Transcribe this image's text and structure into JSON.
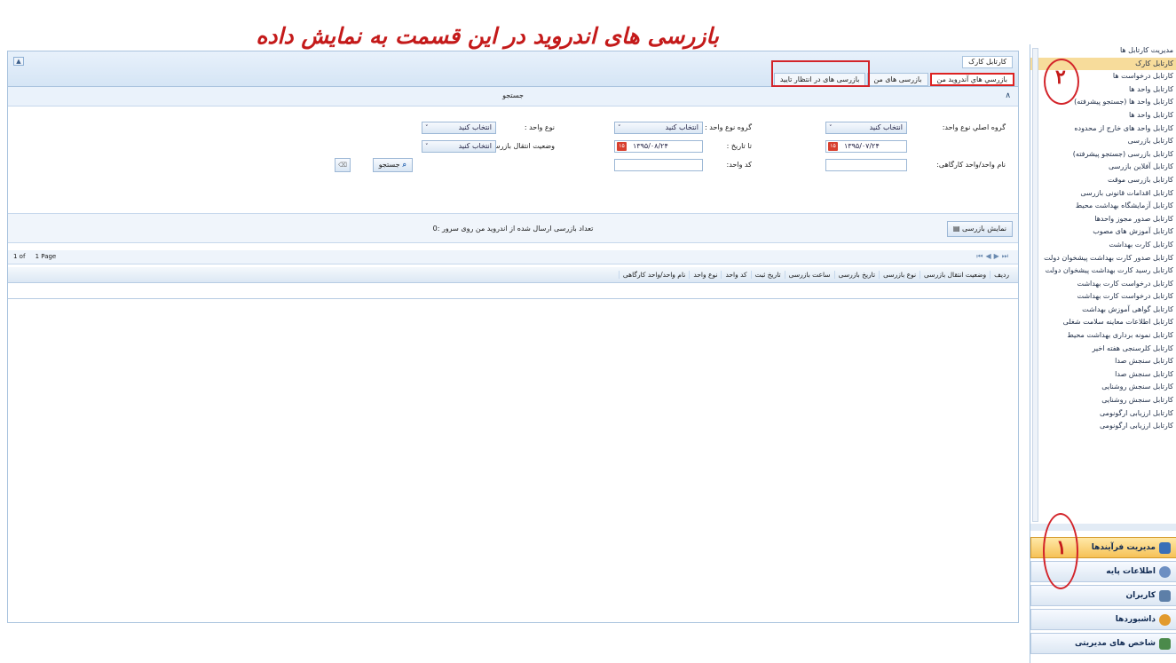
{
  "annotation": {
    "banner_text": "بازرسی های اندروید در این قسمت به نمایش داده می شود",
    "circle_1": "۱",
    "circle_2": "۲"
  },
  "main_panel": {
    "title": "کارتابل کارک",
    "tabs": [
      {
        "label": "بازرسي هاي آندرويد من",
        "active": true
      },
      {
        "label": "بازرسی های من",
        "active": false
      },
      {
        "label": "بازرسی های در انتظار تایید",
        "active": false
      }
    ],
    "collapse_glyph": "▲"
  },
  "search": {
    "header": "جستجو",
    "fields": {
      "main_group_label": "گروه اصلي نوع واحد:",
      "main_group_value": "انتخاب کنید",
      "unit_group_label": "گروه نوع واحد :",
      "unit_group_value": "انتخاب کنيد",
      "unit_type_label": "نوع واحد :",
      "unit_type_value": "انتخاب کنید",
      "from_date_value": "۱۳۹۵/۰۷/۲۴",
      "to_date_label": "تا تاریخ :",
      "to_date_value": "۱۳۹۵/۰۸/۲۴",
      "transfer_status_label": "وضعیت انتقال بازرسی:",
      "transfer_status_value": "انتخاب کنید",
      "unit_name_label": "نام واحد/واحد کارگاهی:",
      "unit_code_label": "کد واحد:",
      "search_button": "جستجو",
      "calendar_glyph": "۱۵"
    }
  },
  "status": {
    "show_button": "نمایش بازرسی",
    "count_text": "تعداد بازرسی ارسال شده از اندروید من روی سرور :0"
  },
  "pager": {
    "page_label": "Page",
    "page_number": "1",
    "of_label": "1 of"
  },
  "grid": {
    "columns": [
      "ردیف",
      "وضعیت انتقال بازرسی",
      "نوع بازرسی",
      "تاریخ بازرسی",
      "ساعت بازرسی",
      "تاریخ ثبت",
      "کد واحد",
      "نوع واحد",
      "نام واحد/واحد کارگاهی"
    ]
  },
  "sidebar": {
    "items": [
      "مدیریت کارتابل ها",
      "کارتابل کارک",
      "کارتابل درخواست ها",
      "کارتابل واحد ها",
      "کارتابل واحد ها (جستجو پیشرفته)",
      "کارتابل واحد ها",
      "کارتابل واحد های خارج از محدوده",
      "کارتابل بازرسی",
      "کارتابل بازرسی (جستجو پیشرفته)",
      "کارتابل آفلاین بازرسی",
      "کارتابل بازرسی موقت",
      "کارتابل اقدامات قانونی بازرسی",
      "کارتابل آزمایشگاه بهداشت محیط",
      "کارتابل صدور مجوز واحدها",
      "کارتابل آموزش های مصوب",
      "کارتابل کارت بهداشت",
      "کارتابل صدور کارت بهداشت پیشخوان دولت",
      "کارتابل رسید کارت بهداشت پیشخوان دولت",
      "کارتابل درخواست کارت بهداشت",
      "کارتابل درخواست کارت بهداشت",
      "کارتابل گواهی آموزش بهداشت",
      "کارتابل اطلاعات معاینه سلامت شغلی",
      "کارتابل نمونه برداری بهداشت محیط",
      "کارتابل کلرسنجی هفته اخیر",
      "کارتابل سنجش صدا",
      "کارتابل سنجش صدا",
      "کارتابل سنجش روشنایی",
      "کارتابل سنجش روشنایی",
      "کارتابل ارزیابی ارگونومی",
      "کارتابل ارزیابی ارگونومی"
    ],
    "selected_index": 1,
    "accordion": [
      {
        "label": "مدیریت فرآیندها",
        "active": true,
        "color": "#3a6fb7"
      },
      {
        "label": "اطلاعات پایه",
        "active": false,
        "color": "#6c8fc2"
      },
      {
        "label": "کاربران",
        "active": false,
        "color": "#5d7fa8"
      },
      {
        "label": "داشبوردها",
        "active": false,
        "color": "#e29a2d"
      },
      {
        "label": "شاخص های مدیریتی",
        "active": false,
        "color": "#4b8a4b"
      }
    ]
  }
}
